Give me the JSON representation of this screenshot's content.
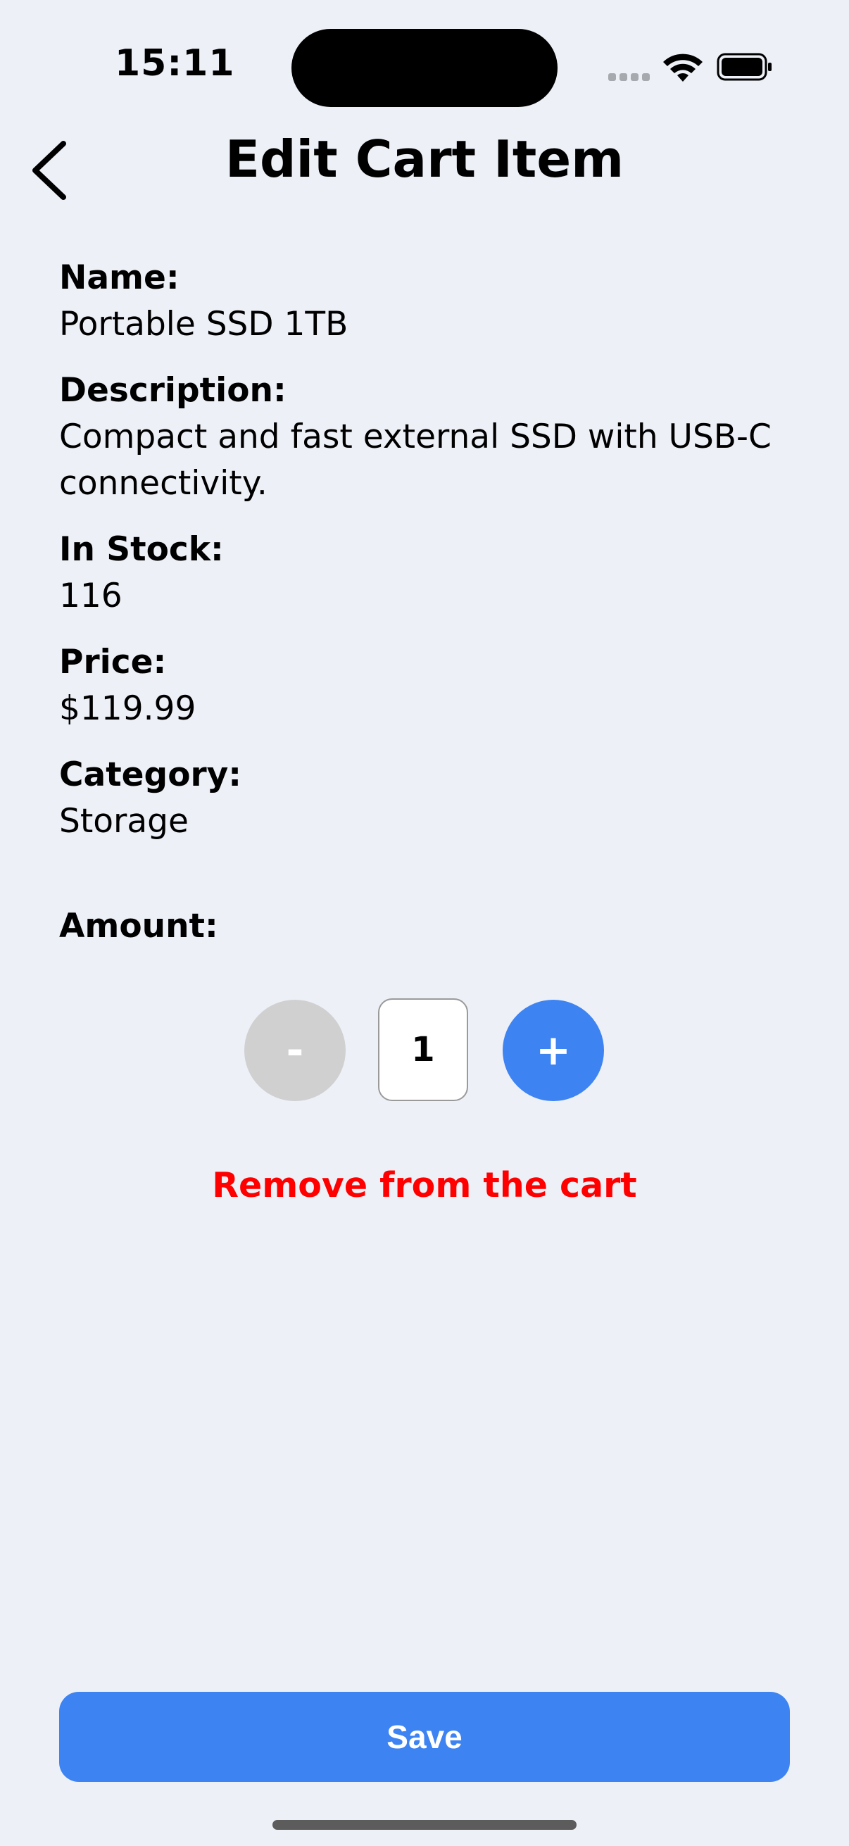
{
  "status_bar": {
    "time": "15:11",
    "icons": [
      "cellular-signal-icon",
      "wifi-icon",
      "battery-icon"
    ]
  },
  "header": {
    "title": "Edit Cart Item",
    "back_icon": "chevron-left-icon"
  },
  "item": {
    "name_label": "Name:",
    "name_value": "Portable SSD 1TB",
    "description_label": "Description:",
    "description_value": "Compact and fast external SSD with USB-C connectivity.",
    "stock_label": "In Stock:",
    "stock_value": "116",
    "price_label": "Price:",
    "price_value": "$119.99",
    "category_label": "Category:",
    "category_value": "Storage"
  },
  "amount": {
    "label": "Amount:",
    "minus_label": "-",
    "quantity": "1",
    "plus_label": "+"
  },
  "remove_label": "Remove from the cart",
  "save_label": "Save",
  "colors": {
    "background": "#edf0f7",
    "accent": "#3d83f2",
    "danger": "#ff0000",
    "disabled": "#d0d0d0"
  }
}
